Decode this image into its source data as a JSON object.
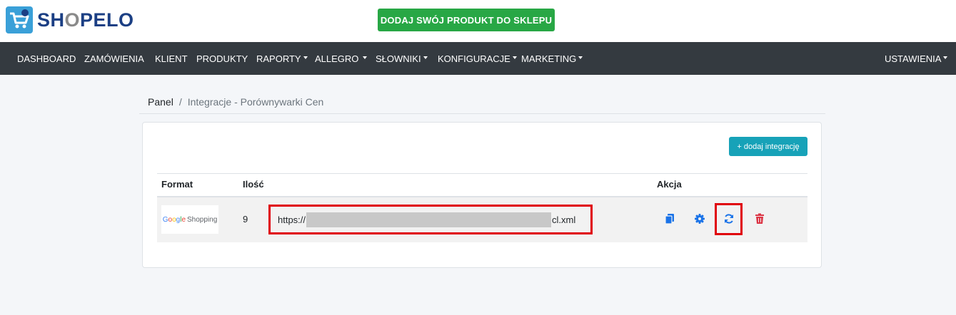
{
  "brand": {
    "name_prefix": "SH",
    "name_o": "O",
    "name_suffix": "PELO"
  },
  "header": {
    "cta_label": "DODAJ SWÓJ PRODUKT DO SKLEPU"
  },
  "nav": {
    "items": [
      {
        "label": "DASHBOARD",
        "dropdown": false
      },
      {
        "label": "ZAMÓWIENIA",
        "dropdown": false
      },
      {
        "label": "KLIENT",
        "dropdown": false
      },
      {
        "label": "PRODUKTY",
        "dropdown": false
      },
      {
        "label": "RAPORTY",
        "dropdown": true
      },
      {
        "label": "ALLEGRO",
        "dropdown": true
      },
      {
        "label": "SŁOWNIKI",
        "dropdown": true
      },
      {
        "label": "KONFIGURACJE",
        "dropdown": true
      },
      {
        "label": "MARKETING",
        "dropdown": true
      }
    ],
    "settings": {
      "label": "USTAWIENIA",
      "dropdown": true
    }
  },
  "breadcrumb": {
    "home": "Panel",
    "separator": "/",
    "current": "Integracje - Porównywarki Cen"
  },
  "card": {
    "add_button": "+ dodaj integrację",
    "table": {
      "headers": {
        "format": "Format",
        "qty": "Ilość",
        "action": "Akcja"
      },
      "rows": [
        {
          "format_logo": {
            "google": [
              "G",
              "o",
              "o",
              "g",
              "l",
              "e"
            ],
            "shopping": "Shopping"
          },
          "qty": "9",
          "url_prefix": "https://",
          "url_suffix": "cl.xml",
          "actions": [
            "copy-icon",
            "gear-icon",
            "refresh-icon",
            "trash-icon"
          ]
        }
      ]
    }
  },
  "colors": {
    "navbar": "#343a40",
    "cta": "#28a745",
    "add_button": "#17a2b8",
    "action_blue": "#1a73e8",
    "delete_red": "#dc3545",
    "highlight_red": "#e0000b"
  }
}
